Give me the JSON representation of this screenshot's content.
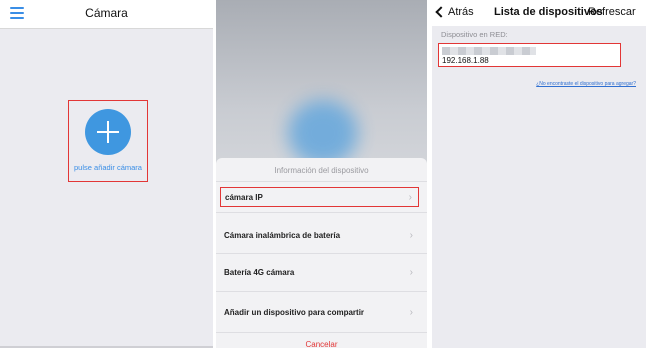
{
  "panel1": {
    "title": "Cámara",
    "add_label": "pulse añadir cámara"
  },
  "panel2": {
    "sheet_title": "Información del dispositivo",
    "options": [
      {
        "label": "cámara IP",
        "selected": true
      },
      {
        "label": "Cámara inalámbrica de batería",
        "selected": false
      },
      {
        "label": "Batería 4G cámara",
        "selected": false
      },
      {
        "label": "Añadir un dispositivo para compartir",
        "selected": false
      }
    ],
    "cancel_label": "Cancelar"
  },
  "panel3": {
    "back_label": "Atrás",
    "title": "Lista de dispositivos",
    "refresh_label": "Refrescar",
    "section_label": "Dispositivo en RED:",
    "device_ip": "192.168.1.88",
    "not_found_link": "¿No encontraste el dispositivo para agregar?"
  },
  "colors": {
    "accent_blue": "#3a8ee6",
    "highlight_red": "#e23636"
  },
  "icons": [
    "menu-icon",
    "add-icon",
    "chevron-right-icon",
    "back-chevron-icon"
  ]
}
